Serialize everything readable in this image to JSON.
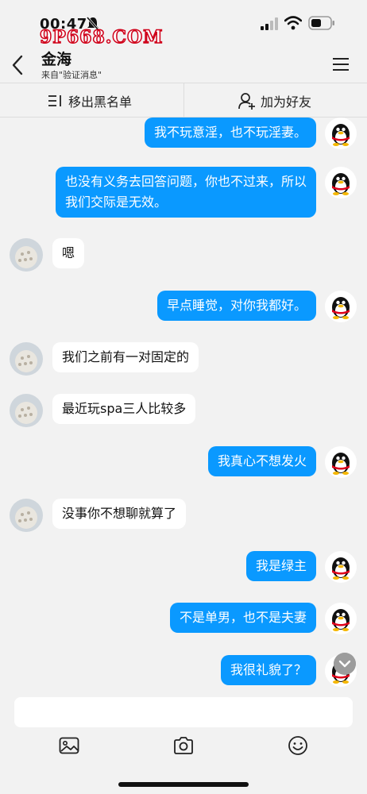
{
  "status_bar": {
    "time": "00:47",
    "watermark": "9P668.COM"
  },
  "header": {
    "title": "金海",
    "subtitle": "来自\"验证消息\""
  },
  "actions": {
    "remove_blacklist": "移出黑名单",
    "add_friend": "加为好友"
  },
  "messages": [
    {
      "side": "out",
      "text": "我不玩意淫，也不玩淫妻。"
    },
    {
      "side": "out",
      "text": "也没有义务去回答问题，你也不过来，所以我们交际是无效。"
    },
    {
      "side": "in",
      "text": "嗯"
    },
    {
      "side": "out",
      "text": "早点睡觉，对你我都好。"
    },
    {
      "side": "in",
      "text": "我们之前有一对固定的"
    },
    {
      "side": "in",
      "text": "最近玩spa三人比较多"
    },
    {
      "side": "out",
      "text": "我真心不想发火"
    },
    {
      "side": "in",
      "text": "没事你不想聊就算了"
    },
    {
      "side": "out",
      "text": "我是绿主"
    },
    {
      "side": "out",
      "text": "不是单男，也不是夫妻"
    },
    {
      "side": "out",
      "text": "我很礼貌了？"
    }
  ],
  "input": {
    "placeholder": ""
  },
  "colors": {
    "bubble_out": "#0a99ff",
    "bubble_in": "#ffffff",
    "background": "#f2f2f2"
  }
}
